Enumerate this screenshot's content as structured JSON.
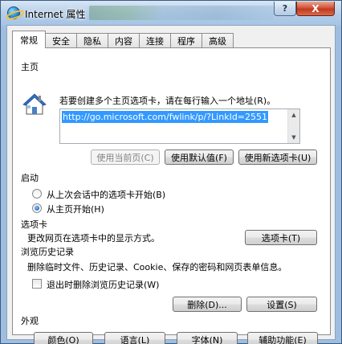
{
  "window": {
    "title": "Internet 属性",
    "help_label": "?",
    "close_label": "X"
  },
  "tabs": [
    {
      "label": "常规",
      "active": true
    },
    {
      "label": "安全",
      "active": false
    },
    {
      "label": "隐私",
      "active": false
    },
    {
      "label": "内容",
      "active": false
    },
    {
      "label": "连接",
      "active": false
    },
    {
      "label": "程序",
      "active": false
    },
    {
      "label": "高级",
      "active": false
    }
  ],
  "home": {
    "section": "主页",
    "instruction": "若要创建多个主页选项卡，请在每行输入一个地址(R)。",
    "url": "http://go.microsoft.com/fwlink/p/?LinkId=2551",
    "buttons": {
      "use_current": "使用当前页(C)",
      "use_default": "使用默认值(F)",
      "use_new_tab": "使用新选项卡(U)"
    }
  },
  "startup": {
    "section": "启动",
    "option_last_session": "从上次会话中的选项卡开始(B)",
    "option_home": "从主页开始(H)",
    "selected": "home"
  },
  "tabs_section": {
    "section": "选项卡",
    "description": "更改网页在选项卡中的显示方式。",
    "button": "选项卡(T)"
  },
  "history": {
    "section": "浏览历史记录",
    "description": "删除临时文件、历史记录、Cookie、保存的密码和网页表单信息。",
    "checkbox_label": "退出时删除浏览历史记录(W)",
    "checkbox_checked": false,
    "delete_button": "删除(D)...",
    "settings_button": "设置(S)"
  },
  "appearance": {
    "section": "外观",
    "colors_button": "颜色(O)",
    "languages_button": "语言(L)",
    "fonts_button": "字体(N)",
    "accessibility_button": "辅助功能(E)"
  }
}
